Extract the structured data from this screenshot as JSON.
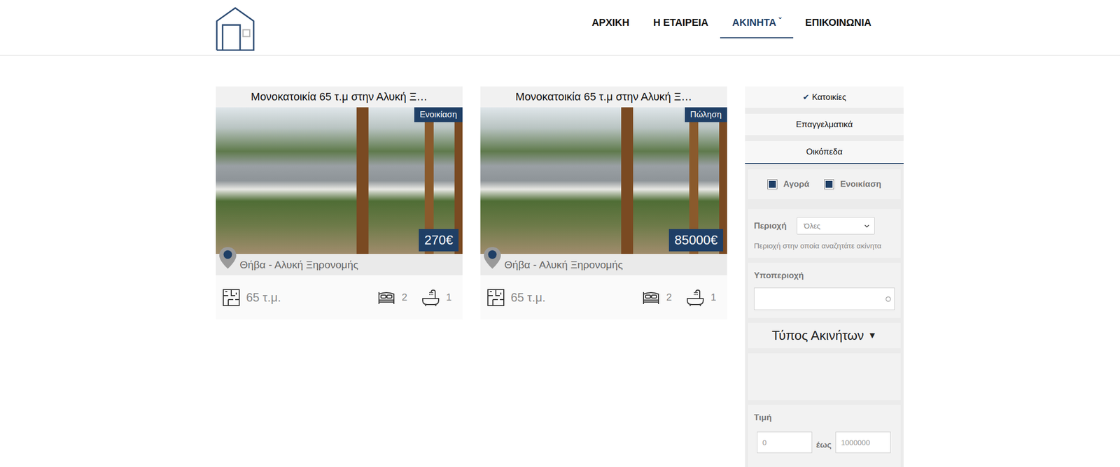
{
  "header": {
    "nav": [
      {
        "label": "ΑΡΧΙΚΗ",
        "selected": false,
        "caret": ""
      },
      {
        "label": "Η ΕΤΑΙΡΕΙΑ",
        "selected": false,
        "caret": ""
      },
      {
        "label": "ΑΚΙΝΗΤΑ",
        "selected": true,
        "caret": "ˇ"
      },
      {
        "label": "ΕΠΙΚΟΙΝΩΝΙΑ",
        "selected": false,
        "caret": ""
      }
    ]
  },
  "listings": [
    {
      "title": "Μονοκατοικία 65 τ.μ στην Αλυκή Ξ…",
      "status": "Ενοικίαση",
      "price": "270€",
      "location": "Θήβα - Αλυκή Ξηρονομής",
      "area": "65 τ.μ.",
      "bedrooms": "2",
      "bathrooms": "1"
    },
    {
      "title": "Μονοκατοικία 65 τ.μ στην Αλυκή Ξ…",
      "status": "Πώληση",
      "price": "85000€",
      "location": "Θήβα - Αλυκή Ξηρονομής",
      "area": "65 τ.μ.",
      "bedrooms": "2",
      "bathrooms": "1"
    }
  ],
  "sidebar": {
    "checkIcon": "✔",
    "categories": [
      {
        "label": "Κατοικίες",
        "selected": true
      },
      {
        "label": "Επαγγελματικά",
        "selected": false
      },
      {
        "label": "Οικόπεδα",
        "selected": false
      }
    ],
    "transaction": [
      {
        "label": "Αγορά",
        "checked": true
      },
      {
        "label": "Ενοικίαση",
        "checked": true
      }
    ],
    "region": {
      "label": "Περιοχή",
      "value": "Όλες",
      "hint": "Περιοχή στην οποία αναζητάτε ακίνητα"
    },
    "subregion": {
      "label": "Υποπεριοχή",
      "value": ""
    },
    "types": {
      "label": "Τύπος Ακινήτων",
      "arrow": "▼",
      "expanded": false
    },
    "price": {
      "label": "Τιμή",
      "min": "0",
      "separator": "έως",
      "max": "1000000"
    }
  }
}
